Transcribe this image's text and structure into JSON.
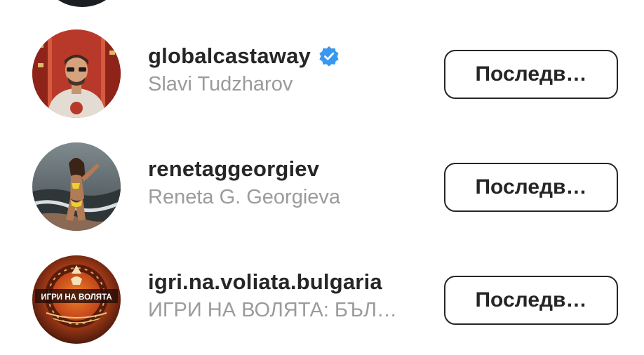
{
  "accounts": [
    {
      "username": "globalcastaway",
      "full_name": "Slavi Tudzharov",
      "verified": true,
      "avatar_icon": "avatar-photo-man-in-red-corridor",
      "button_label": "Последв…"
    },
    {
      "username": "renetaggeorgiev",
      "full_name": "Reneta G. Georgieva",
      "verified": false,
      "avatar_icon": "avatar-photo-woman-at-beach",
      "button_label": "Последв…"
    },
    {
      "username": "igri.na.voliata.bulgaria",
      "full_name": "ИГРИ НА ВОЛЯТА: БЪЛ…",
      "verified": false,
      "avatar_icon": "avatar-logo-igri-na-volyata",
      "button_label": "Последв…",
      "avatar_text": "ИГРИ НА ВОЛЯТА"
    }
  ],
  "colors": {
    "text_primary": "#262626",
    "text_secondary": "#9b9b9b",
    "verified_blue": "#3897f0"
  }
}
